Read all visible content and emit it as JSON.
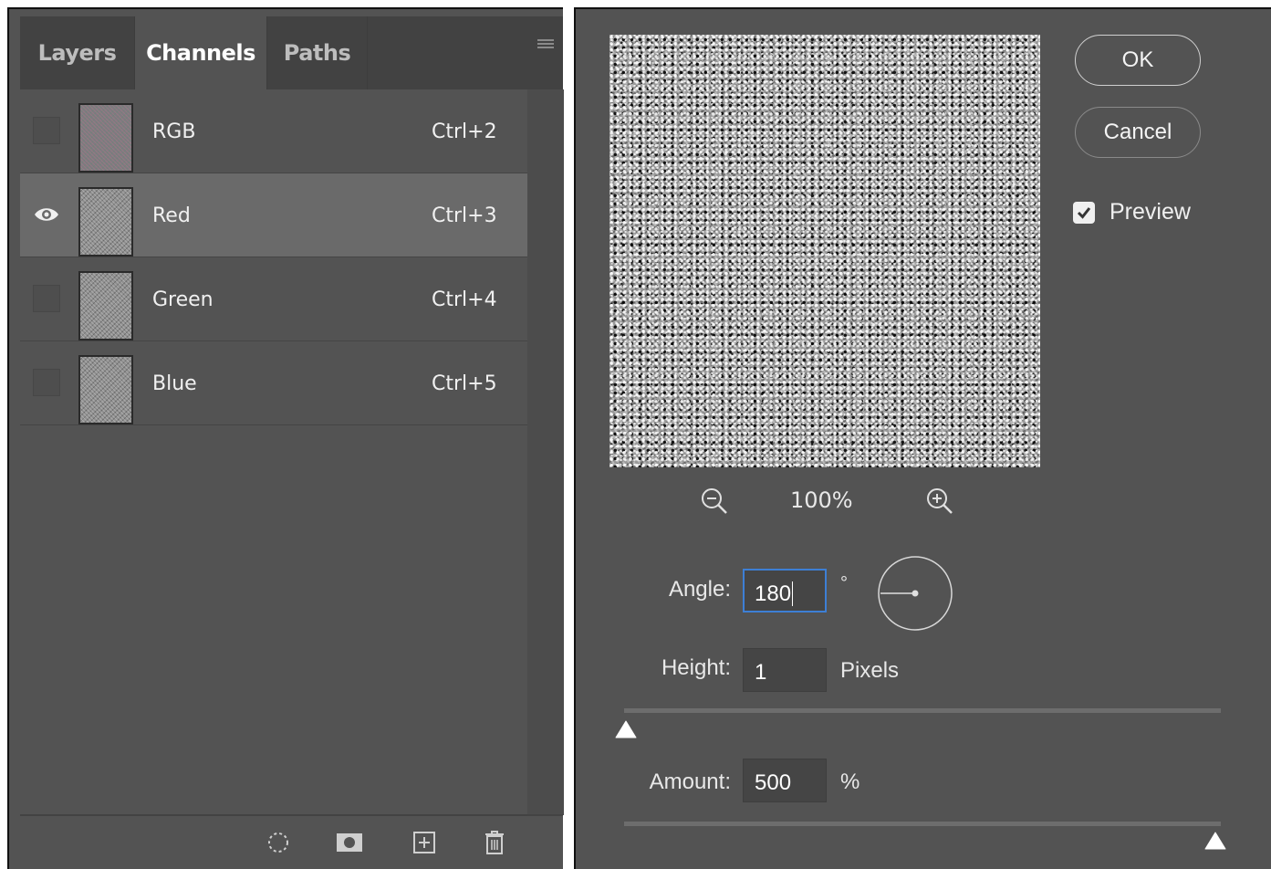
{
  "channels_panel": {
    "tabs": [
      {
        "label": "Layers",
        "active": false
      },
      {
        "label": "Channels",
        "active": true
      },
      {
        "label": "Paths",
        "active": false
      }
    ],
    "channels": [
      {
        "name": "RGB",
        "shortcut": "Ctrl+2",
        "visible": false,
        "selected": false
      },
      {
        "name": "Red",
        "shortcut": "Ctrl+3",
        "visible": true,
        "selected": true
      },
      {
        "name": "Green",
        "shortcut": "Ctrl+4",
        "visible": false,
        "selected": false
      },
      {
        "name": "Blue",
        "shortcut": "Ctrl+5",
        "visible": false,
        "selected": false
      }
    ],
    "bottom_icons": [
      "load-selection-icon",
      "save-selection-mask-icon",
      "new-channel-icon",
      "delete-channel-icon"
    ]
  },
  "emboss_dialog": {
    "ok_label": "OK",
    "cancel_label": "Cancel",
    "preview_label": "Preview",
    "preview_checked": true,
    "zoom_level": "100%",
    "angle": {
      "label": "Angle:",
      "value": "180",
      "unit": "°"
    },
    "height": {
      "label": "Height:",
      "value": "1",
      "unit": "Pixels",
      "slider_fraction": 0.0
    },
    "amount": {
      "label": "Amount:",
      "value": "500",
      "unit": "%",
      "slider_fraction": 1.0
    }
  },
  "colors": {
    "panel_bg": "#535353",
    "selected_row": "#6a6a6a",
    "focus_blue": "#3d7fd5"
  }
}
